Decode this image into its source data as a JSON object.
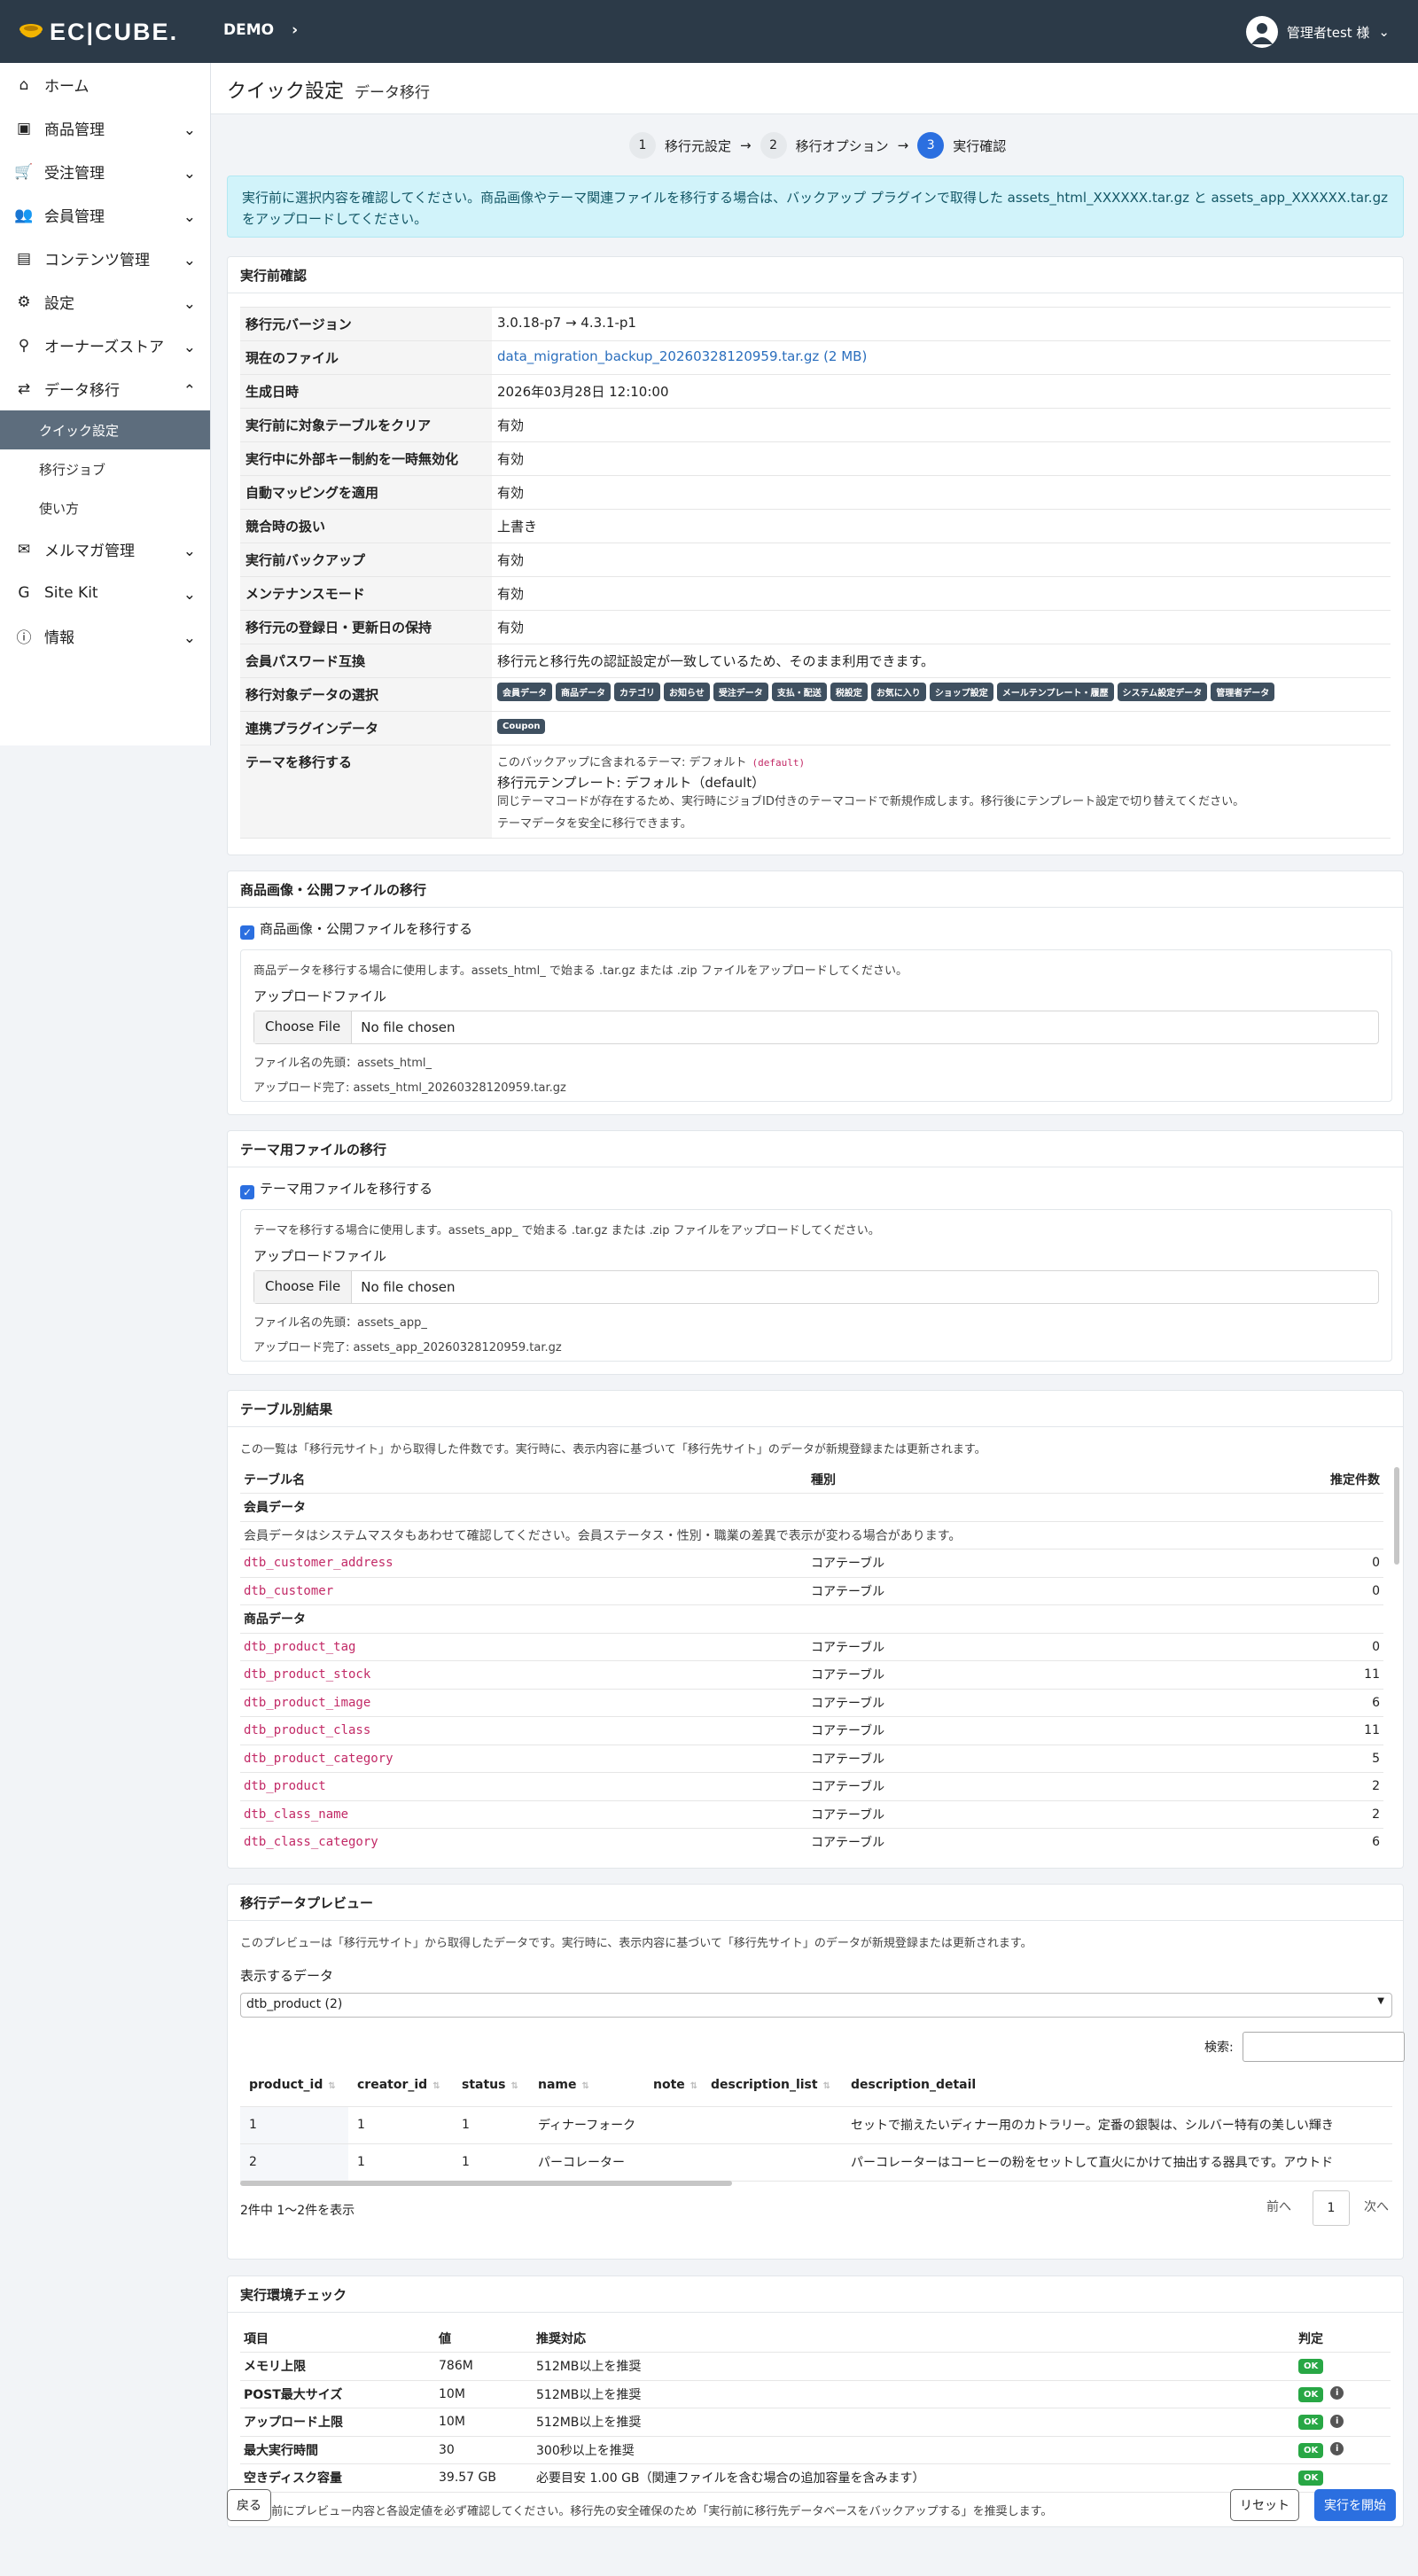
{
  "header": {
    "logo": "EC|CUBE.",
    "shop": "DEMO",
    "user": "管理者test 様"
  },
  "sidebar": {
    "items": [
      {
        "label": "ホーム",
        "icon": "home-icon",
        "chev": false
      },
      {
        "label": "商品管理",
        "icon": "box-icon",
        "chev": true
      },
      {
        "label": "受注管理",
        "icon": "cart-icon",
        "chev": true
      },
      {
        "label": "会員管理",
        "icon": "users-icon",
        "chev": true
      },
      {
        "label": "コンテンツ管理",
        "icon": "file-icon",
        "chev": true
      },
      {
        "label": "設定",
        "icon": "gear-icon",
        "chev": true
      },
      {
        "label": "オーナーズストア",
        "icon": "plug-icon",
        "chev": true
      },
      {
        "label": "データ移行",
        "icon": "shuffle-icon",
        "chev": "up"
      }
    ],
    "subitems": [
      "クイック設定",
      "移行ジョブ",
      "使い方"
    ],
    "items2": [
      {
        "label": "メルマガ管理",
        "icon": "mail-icon"
      },
      {
        "label": "Site Kit",
        "icon": "g-icon"
      },
      {
        "label": "情報",
        "icon": "info-icon"
      }
    ]
  },
  "page": {
    "title": "クイック設定",
    "subtitle": "データ移行"
  },
  "steps": [
    {
      "n": "1",
      "label": "移行元設定"
    },
    {
      "n": "2",
      "label": "移行オプション"
    },
    {
      "n": "3",
      "label": "実行確認"
    }
  ],
  "alert": "実行前に選択内容を確認してください。商品画像やテーマ関連ファイルを移行する場合は、バックアップ プラグインで取得した assets_html_XXXXXX.tar.gz と assets_app_XXXXXX.tar.gz をアップロードしてください。",
  "confirm": {
    "title": "実行前確認",
    "rows": [
      {
        "k": "移行元バージョン",
        "v": "3.0.18-p7 → 4.3.1-p1"
      },
      {
        "k": "現在のファイル",
        "v": "data_migration_backup_20260328120959.tar.gz (2 MB)"
      },
      {
        "k": "生成日時",
        "v": "2026年03月28日 12:10:00"
      },
      {
        "k": "実行前に対象テーブルをクリア",
        "v": "有効"
      },
      {
        "k": "実行中に外部キー制約を一時無効化",
        "v": "有効"
      },
      {
        "k": "自動マッピングを適用",
        "v": "有効"
      },
      {
        "k": "競合時の扱い",
        "v": "上書き"
      },
      {
        "k": "実行前バックアップ",
        "v": "有効"
      },
      {
        "k": "メンテナンスモード",
        "v": "有効"
      },
      {
        "k": "移行元の登録日・更新日の保持",
        "v": "有効"
      },
      {
        "k": "会員パスワード互換",
        "v": "移行元と移行先の認証設定が一致しているため、そのまま利用できます。"
      },
      {
        "k": "移行対象データの選択",
        "v": ""
      },
      {
        "k": "連携プラグインデータ",
        "v": ""
      },
      {
        "k": "テーマを移行する",
        "v": ""
      }
    ],
    "badges": [
      "会員データ",
      "商品データ",
      "カテゴリ",
      "お知らせ",
      "受注データ",
      "支払・配送",
      "税設定",
      "お気に入り",
      "ショップ設定",
      "メールテンプレート・履歴",
      "システム設定データ",
      "管理者データ"
    ],
    "plugin_badge": "Coupon",
    "theme": {
      "l1": "このバックアップに含まれるテーマ: デフォルト",
      "l1code": "(default)",
      "l2": "移行元テンプレート: デフォルト（default）",
      "l3": "同じテーマコードが存在するため、実行時にジョブID付きのテーマコードで新規作成します。移行後にテンプレート設定で切り替えてください。",
      "l4": "テーマデータを安全に移行できます。"
    }
  },
  "assets": {
    "title": "商品画像・公開ファイルの移行",
    "check": "商品画像・公開ファイルを移行する",
    "desc": "商品データを移行する場合に使用します。assets_html_ で始まる .tar.gz または .zip ファイルをアップロードしてください。",
    "upload": "アップロードファイル",
    "btn": "Choose File",
    "nofile": "No file chosen",
    "prefix": "ファイル名の先頭：assets_html_",
    "done": "アップロード完了: assets_html_20260328120959.tar.gz"
  },
  "theme_files": {
    "title": "テーマ用ファイルの移行",
    "check": "テーマ用ファイルを移行する",
    "desc": "テーマを移行する場合に使用します。assets_app_ で始まる .tar.gz または .zip ファイルをアップロードしてください。",
    "upload": "アップロードファイル",
    "btn": "Choose File",
    "nofile": "No file chosen",
    "prefix": "ファイル名の先頭：assets_app_",
    "done": "アップロード完了: assets_app_20260328120959.tar.gz"
  },
  "tables": {
    "title": "テーブル別結果",
    "desc": "この一覧は「移行元サイト」から取得した件数です。実行時に、表示内容に基づいて「移行先サイト」のデータが新規登録または更新されます。",
    "headers": [
      "テーブル名",
      "種別",
      "推定件数"
    ],
    "group1": "会員データ",
    "group1note": "会員データはシステムマスタもあわせて確認してください。会員ステータス・性別・職業の差異で表示が変わる場合があります。",
    "rows1": [
      {
        "n": "dtb_customer_address",
        "t": "コアテーブル",
        "c": "0"
      },
      {
        "n": "dtb_customer",
        "t": "コアテーブル",
        "c": "0"
      }
    ],
    "group2": "商品データ",
    "rows2": [
      {
        "n": "dtb_product_tag",
        "t": "コアテーブル",
        "c": "0"
      },
      {
        "n": "dtb_product_stock",
        "t": "コアテーブル",
        "c": "11"
      },
      {
        "n": "dtb_product_image",
        "t": "コアテーブル",
        "c": "6"
      },
      {
        "n": "dtb_product_class",
        "t": "コアテーブル",
        "c": "11"
      },
      {
        "n": "dtb_product_category",
        "t": "コアテーブル",
        "c": "5"
      },
      {
        "n": "dtb_product",
        "t": "コアテーブル",
        "c": "2"
      },
      {
        "n": "dtb_class_name",
        "t": "コアテーブル",
        "c": "2"
      },
      {
        "n": "dtb_class_category",
        "t": "コアテーブル",
        "c": "6"
      }
    ]
  },
  "preview": {
    "title": "移行データプレビュー",
    "desc": "このプレビューは「移行元サイト」から取得したデータです。実行時に、表示内容に基づいて「移行先サイト」のデータが新規登録または更新されます。",
    "select_label": "表示するデータ",
    "select_value": "dtb_product (2)",
    "search": "検索:",
    "cols": [
      "product_id",
      "creator_id",
      "status",
      "name",
      "note",
      "description_list",
      "description_detail"
    ],
    "rows": [
      [
        "1",
        "1",
        "1",
        "ディナーフォーク",
        "",
        "",
        "セットで揃えたいディナー用のカトラリー。定番の銀製は、シルバー特有の美しい輝き"
      ],
      [
        "2",
        "1",
        "1",
        "パーコレーター",
        "",
        "",
        "パーコレーターはコーヒーの粉をセットして直火にかけて抽出する器具です。アウトド"
      ]
    ],
    "info": "2件中 1〜2件を表示",
    "prev": "前へ",
    "page": "1",
    "next": "次へ"
  },
  "env": {
    "title": "実行環境チェック",
    "headers": [
      "項目",
      "値",
      "推奨対応",
      "判定"
    ],
    "rows": [
      {
        "k": "メモリ上限",
        "v": "786M",
        "r": "512MB以上を推奨",
        "i": false
      },
      {
        "k": "POST最大サイズ",
        "v": "10M",
        "r": "512MB以上を推奨",
        "i": true
      },
      {
        "k": "アップロード上限",
        "v": "10M",
        "r": "512MB以上を推奨",
        "i": true
      },
      {
        "k": "最大実行時間",
        "v": "30",
        "r": "300秒以上を推奨",
        "i": true
      },
      {
        "k": "空きディスク容量",
        "v": "39.57 GB",
        "r": "必要目安 1.00 GB（関連ファイルを含む場合の追加容量を含みます）",
        "i": false
      }
    ],
    "ok": "OK",
    "note": "実行前にプレビュー内容と各設定値を必ず確認してください。移行先の安全確保のため「実行前に移行先データベースをバックアップする」を推奨します。"
  },
  "footer": {
    "back": "戻る",
    "reset": "リセット",
    "run": "実行を開始"
  }
}
